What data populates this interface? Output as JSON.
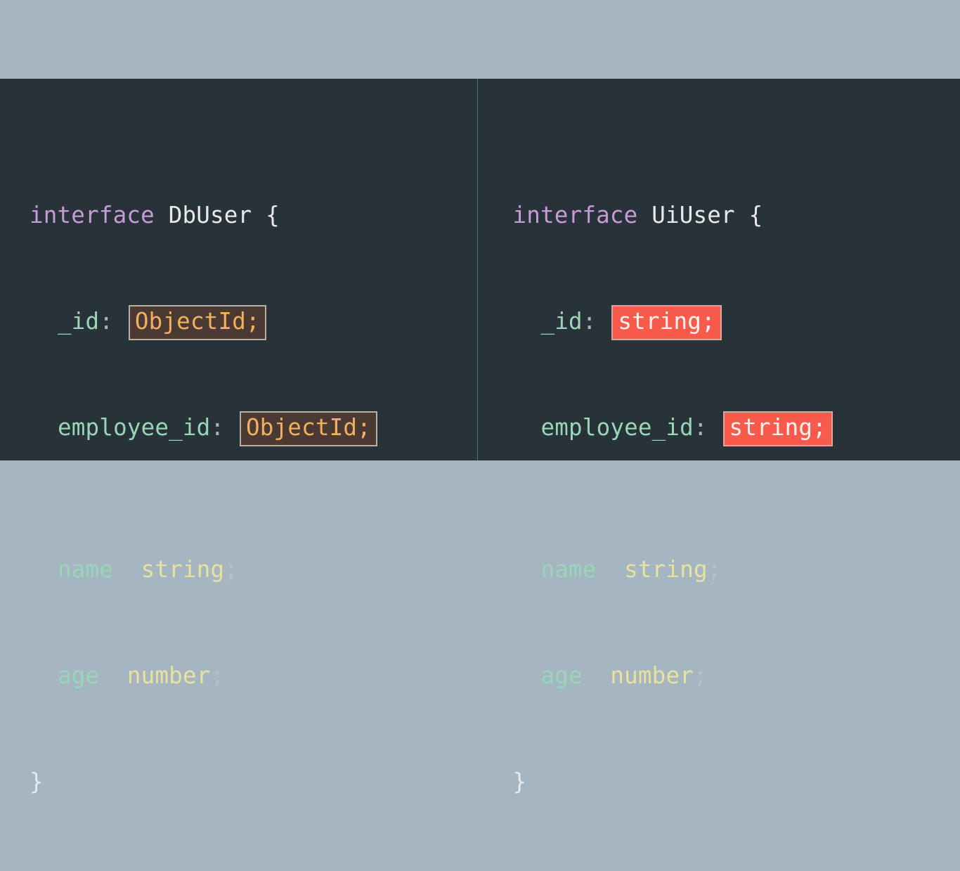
{
  "keyword": "interface",
  "openBrace": "{",
  "closeBrace": "}",
  "left": {
    "interfaceName": "DbUser",
    "props": {
      "p0": {
        "name": "_id",
        "type": "ObjectId;",
        "highlight": "brown"
      },
      "p1": {
        "name": "employee_id",
        "type": "ObjectId;",
        "highlight": "brown"
      },
      "p2": {
        "name": "name",
        "type": "string"
      },
      "p3": {
        "name": "age",
        "type": "number"
      }
    }
  },
  "right": {
    "interfaceName": "UiUser",
    "props": {
      "p0": {
        "name": "_id",
        "type": "string;",
        "highlight": "red"
      },
      "p1": {
        "name": "employee_id",
        "type": "string;",
        "highlight": "red"
      },
      "p2": {
        "name": "name",
        "type": "string"
      },
      "p3": {
        "name": "age",
        "type": "number"
      }
    }
  },
  "semicolon": ";",
  "colon": ":"
}
